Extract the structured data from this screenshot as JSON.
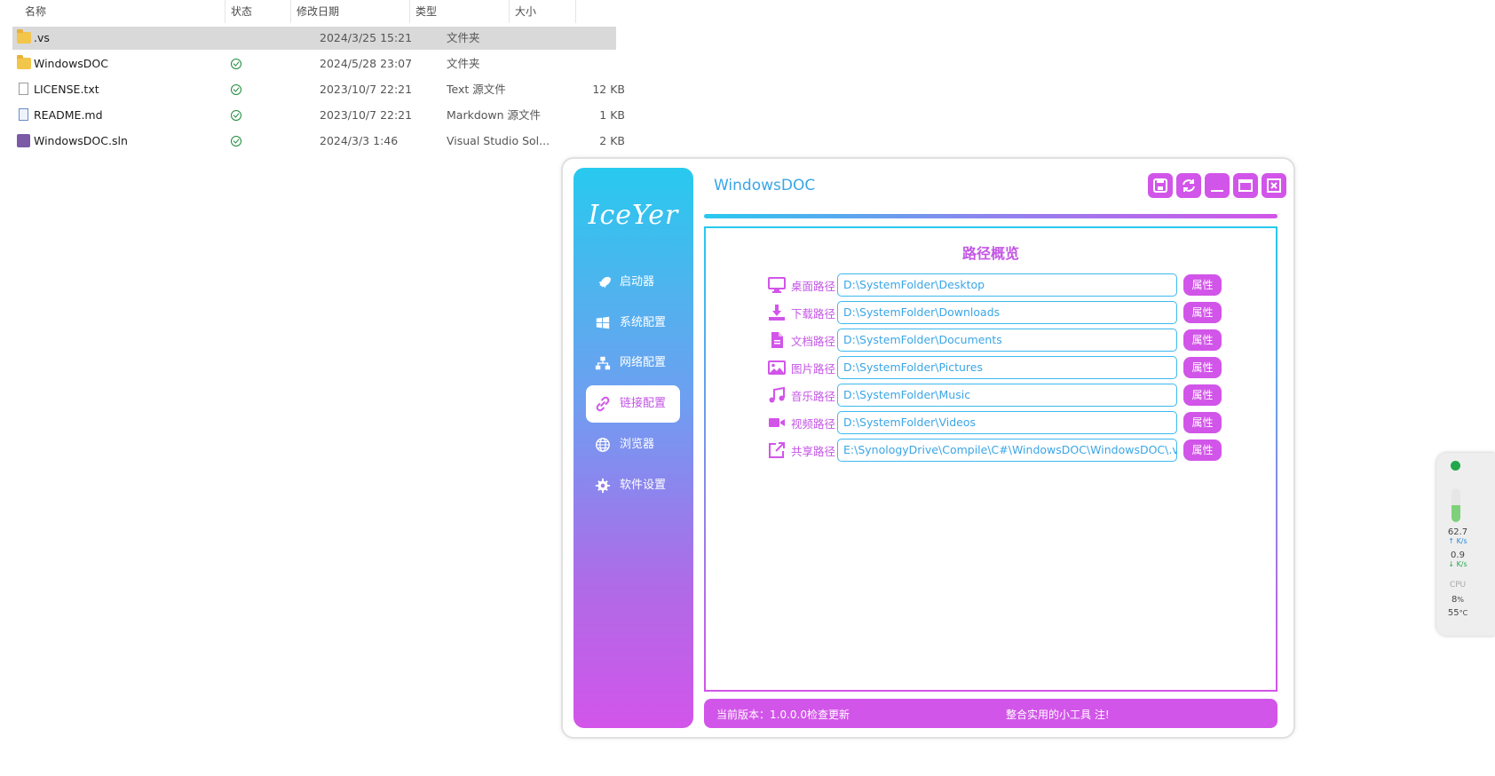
{
  "explorer": {
    "columns": {
      "name": "名称",
      "status": "状态",
      "modified": "修改日期",
      "type": "类型",
      "size": "大小"
    },
    "files": [
      {
        "name": ".vs",
        "status": "",
        "modified": "2024/3/25 15:21",
        "type": "文件夹",
        "size": "",
        "icon": "folder-icon"
      },
      {
        "name": "WindowsDOC",
        "status": "synced",
        "modified": "2024/5/28 23:07",
        "type": "文件夹",
        "size": "",
        "icon": "folder-icon"
      },
      {
        "name": "LICENSE.txt",
        "status": "synced",
        "modified": "2023/10/7 22:21",
        "type": "Text 源文件",
        "size": "12 KB",
        "icon": "text-file-icon"
      },
      {
        "name": "README.md",
        "status": "synced",
        "modified": "2023/10/7 22:21",
        "type": "Markdown 源文件",
        "size": "1 KB",
        "icon": "markdown-file-icon"
      },
      {
        "name": "WindowsDOC.sln",
        "status": "synced",
        "modified": "2024/3/3 1:46",
        "type": "Visual Studio Sol...",
        "size": "2 KB",
        "icon": "solution-file-icon"
      }
    ]
  },
  "app": {
    "logo": "IceYer",
    "title": "WindowsDOC",
    "nav": [
      {
        "label": "启动器",
        "icon": "rocket-icon"
      },
      {
        "label": "系统配置",
        "icon": "windows-icon"
      },
      {
        "label": "网络配置",
        "icon": "network-icon"
      },
      {
        "label": "链接配置",
        "icon": "link-icon",
        "active": true
      },
      {
        "label": "浏览器",
        "icon": "globe-icon"
      },
      {
        "label": "软件设置",
        "icon": "gear-icon"
      }
    ],
    "panel_title": "路径概览",
    "paths": [
      {
        "label": "桌面路径",
        "value": "D:\\SystemFolder\\Desktop",
        "button": "属性",
        "icon": "monitor-icon"
      },
      {
        "label": "下载路径",
        "value": "D:\\SystemFolder\\Downloads",
        "button": "属性",
        "icon": "download-icon"
      },
      {
        "label": "文档路径",
        "value": "D:\\SystemFolder\\Documents",
        "button": "属性",
        "icon": "document-icon"
      },
      {
        "label": "图片路径",
        "value": "D:\\SystemFolder\\Pictures",
        "button": "属性",
        "icon": "image-icon"
      },
      {
        "label": "音乐路径",
        "value": "D:\\SystemFolder\\Music",
        "button": "属性",
        "icon": "music-icon"
      },
      {
        "label": "视频路径",
        "value": "D:\\SystemFolder\\Videos",
        "button": "属性",
        "icon": "video-icon"
      },
      {
        "label": "共享路径",
        "value": "E:\\SynologyDrive\\Compile\\C#\\WindowsDOC\\WindowsDOC\\.vs",
        "button": "属性",
        "icon": "share-icon"
      }
    ],
    "footer": {
      "version_label": "当前版本：1.0.0.0",
      "check_update": "检查更新",
      "slogan": "整合实用的小工具 注!"
    },
    "colors": {
      "accent": "#d255e9",
      "cyan": "#28c9ee",
      "text_blue": "#3aa6e6"
    }
  },
  "netmon": {
    "upload": "62.7",
    "upload_unit": "K/s",
    "download": "0.9",
    "download_unit": "K/s",
    "cpu_label": "CPU",
    "cpu_value": "8",
    "cpu_unit": "%",
    "temp_value": "55",
    "temp_unit": "°C"
  }
}
